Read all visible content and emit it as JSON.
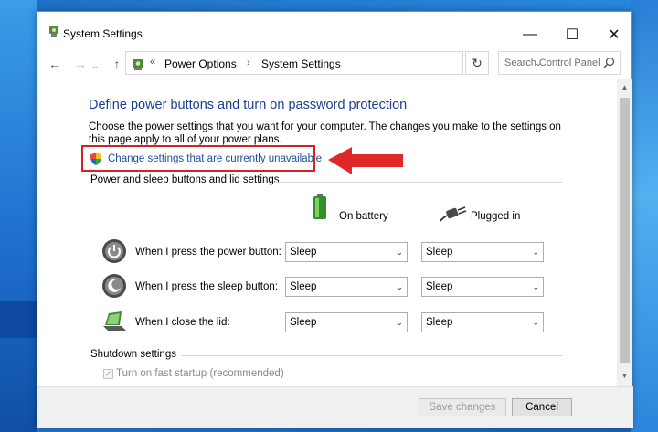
{
  "window": {
    "title": "System Settings",
    "controls": {
      "minimize": "—",
      "maximize": "☐",
      "close": "✕"
    }
  },
  "nav": {
    "back": "←",
    "forward": "→",
    "recent": "⌄",
    "up": "↑",
    "breadcrumb_sep": "«",
    "breadcrumb": [
      "Power Options",
      "System Settings"
    ],
    "crumb_sep": "›",
    "dropdown": "⌄",
    "refresh": "↻",
    "search_placeholder": "Search Control Panel"
  },
  "main": {
    "heading": "Define power buttons and turn on password protection",
    "description": "Choose the power settings that you want for your computer. The changes you make to the settings on this page apply to all of your power plans.",
    "change_link": "Change settings that are currently unavailable",
    "power_section": "Power and sleep buttons and lid settings",
    "columns": {
      "battery": "On battery",
      "plugged": "Plugged in"
    },
    "rows": [
      {
        "label": "When I press the power button:",
        "battery": "Sleep",
        "plugged": "Sleep",
        "icon": "power-button-icon"
      },
      {
        "label": "When I press the sleep button:",
        "battery": "Sleep",
        "plugged": "Sleep",
        "icon": "sleep-button-icon"
      },
      {
        "label": "When I close the lid:",
        "battery": "Sleep",
        "plugged": "Sleep",
        "icon": "laptop-lid-icon"
      }
    ],
    "shutdown_section": "Shutdown settings",
    "fast_startup": "Turn on fast startup (recommended)",
    "fast_startup_checked": true
  },
  "footer": {
    "save": "Save changes",
    "cancel": "Cancel"
  },
  "colors": {
    "heading": "#1c3f93",
    "link": "#1f4f9c",
    "highlight": "#d3222a"
  }
}
